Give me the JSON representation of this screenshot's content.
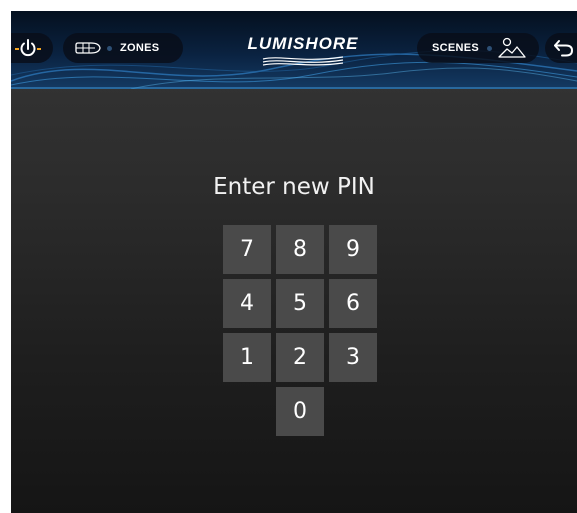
{
  "header": {
    "power": {
      "icon": "power-icon"
    },
    "zones": {
      "label": "ZONES",
      "icon": "boat-outline-icon"
    },
    "logo": {
      "text": "LUMISHORE"
    },
    "scenes": {
      "label": "SCENES",
      "icon": "landscape-icon"
    },
    "back": {
      "icon": "back-arrow-icon"
    }
  },
  "prompt": "Enter new PIN",
  "keypad": {
    "keys": [
      "7",
      "8",
      "9",
      "4",
      "5",
      "6",
      "1",
      "2",
      "3",
      "0"
    ]
  },
  "colors": {
    "accent": "#f5a623",
    "header_bg": "#0a2240",
    "key_bg": "#4a4a4a",
    "screen_bg": "#2c2c2c"
  }
}
